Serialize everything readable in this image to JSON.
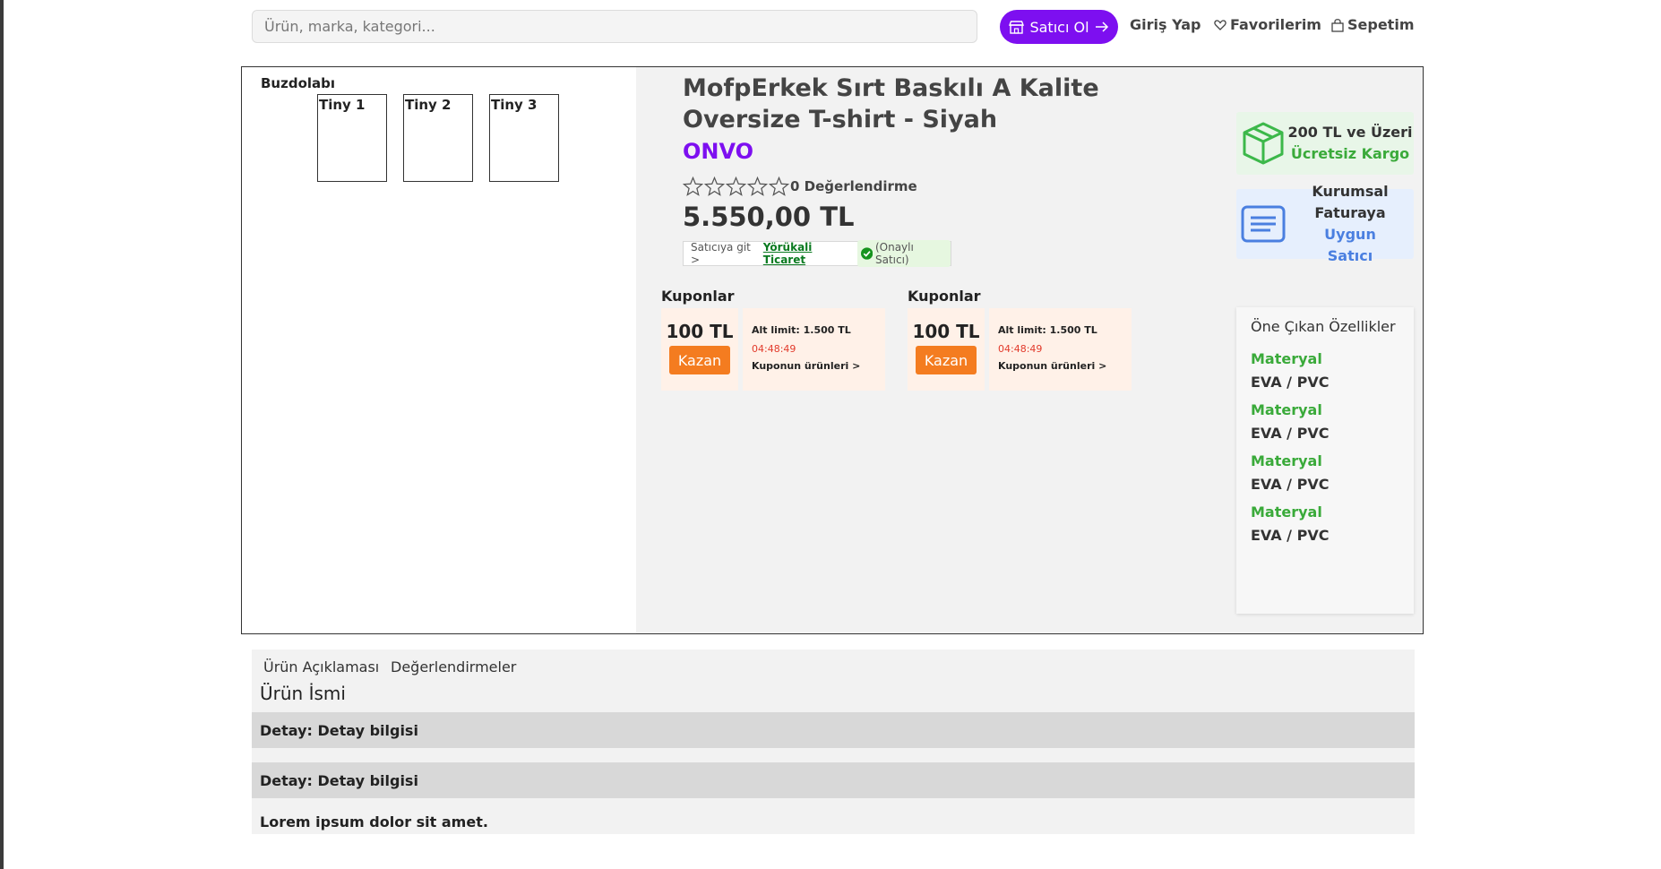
{
  "header": {
    "search_placeholder": "Ürün, marka, kategori...",
    "seller_button": "Satıcı Ol",
    "login": "Giriş Yap",
    "favorites": "Favorilerim",
    "cart": "Sepetim"
  },
  "gallery": {
    "title": "Buzdolabı",
    "thumbs": [
      "Tiny 1",
      "Tiny 2",
      "Tiny 3"
    ]
  },
  "product": {
    "title": "MofpErkek Sırt Baskılı A Kalite Oversize T-shirt - Siyah",
    "brand": "ONVO",
    "rating_stars": 0,
    "rating_text": "0 Değerlendirme",
    "price": "5.550,00 TL",
    "seller_prefix": "Satıcıya git >",
    "seller_name": "Yörükali Ticaret",
    "seller_verified": "(Onaylı Satıcı)"
  },
  "coupons": [
    {
      "label": "Kuponlar",
      "amount": "100 TL",
      "button": "Kazan",
      "limit": "Alt limit: 1.500 TL",
      "timer": "04:48:49",
      "link": "Kuponun ürünleri >"
    },
    {
      "label": "Kuponlar",
      "amount": "100 TL",
      "button": "Kazan",
      "limit": "Alt limit: 1.500 TL",
      "timer": "04:48:49",
      "link": "Kuponun ürünleri >"
    }
  ],
  "badges": {
    "cargo_line1": "200 TL ve Üzeri",
    "cargo_line2": "Ücretsiz Kargo",
    "invoice_line1": "Kurumsal",
    "invoice_line2a": "Faturaya",
    "invoice_line2b": "Uygun",
    "invoice_line3": "Satıcı"
  },
  "features": {
    "title": "Öne Çıkan Özellikler",
    "items": [
      {
        "key": "Materyal",
        "value": "EVA / PVC"
      },
      {
        "key": "Materyal",
        "value": "EVA / PVC"
      },
      {
        "key": "Materyal",
        "value": "EVA / PVC"
      },
      {
        "key": "Materyal",
        "value": "EVA / PVC"
      }
    ]
  },
  "description": {
    "tabs": [
      "Ürün Açıklaması",
      "Değerlendirmeler"
    ],
    "title": "Ürün İsmi",
    "details": [
      "Detay: Detay bilgisi",
      "Detay: Detay bilgisi"
    ],
    "lorem": "Lorem ipsum dolor sit amet."
  },
  "colors": {
    "brand_purple": "#7d0ff0",
    "coupon_orange": "#f47c20",
    "feature_green": "#3aaa3a",
    "invoice_blue": "#4a7fe0"
  }
}
